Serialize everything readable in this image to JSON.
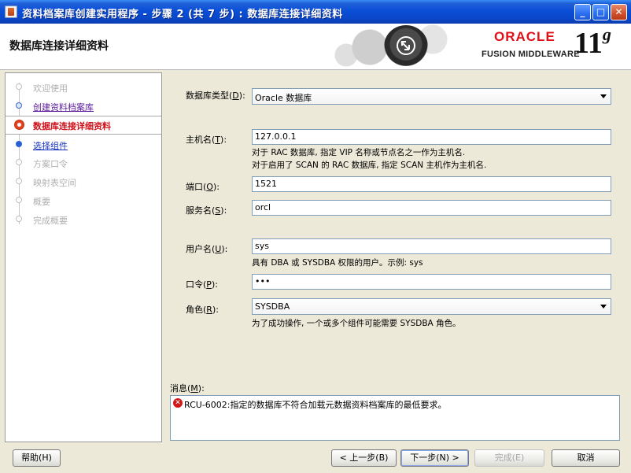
{
  "window": {
    "title": "资料档案库创建实用程序 - 步骤 2 (共 7 步) : 数据库连接详细资料",
    "minimize": "_",
    "maximize": "□",
    "close": "✕"
  },
  "header": {
    "page_title": "数据库连接详细资料",
    "brand_oracle": "ORACLE",
    "brand_fmw": "FUSION MIDDLEWARE",
    "version": "11",
    "version_suffix": "g"
  },
  "nav": {
    "steps": [
      {
        "label": "欢迎使用",
        "state": "disabled"
      },
      {
        "label": "创建资料档案库",
        "state": "done"
      },
      {
        "label": "数据库连接详细资料",
        "state": "current"
      },
      {
        "label": "选择组件",
        "state": "next"
      },
      {
        "label": "方案口令",
        "state": "disabled"
      },
      {
        "label": "映射表空间",
        "state": "disabled"
      },
      {
        "label": "概要",
        "state": "disabled"
      },
      {
        "label": "完成概要",
        "state": "disabled"
      }
    ]
  },
  "form": {
    "db_type": {
      "label": "数据库类型(",
      "mnemonic": "D",
      "label_end": "):",
      "value": "Oracle 数据库"
    },
    "host": {
      "label": "主机名(",
      "mnemonic": "T",
      "label_end": "):",
      "value": "127.0.0.1",
      "hint1": "对于 RAC 数据库, 指定 VIP 名称或节点名之一作为主机名.",
      "hint2": "对于启用了 SCAN 的 RAC 数据库, 指定 SCAN 主机作为主机名."
    },
    "port": {
      "label": "端口(",
      "mnemonic": "O",
      "label_end": "):",
      "value": "1521"
    },
    "service": {
      "label": "服务名(",
      "mnemonic": "S",
      "label_end": "):",
      "value": "orcl"
    },
    "user": {
      "label": "用户名(",
      "mnemonic": "U",
      "label_end": "):",
      "value": "sys",
      "hint": "具有 DBA 或 SYSDBA 权限的用户。示例: sys"
    },
    "password": {
      "label": "口令(",
      "mnemonic": "P",
      "label_end": "):",
      "value": "•••"
    },
    "role": {
      "label": "角色(",
      "mnemonic": "R",
      "label_end": "):",
      "value": "SYSDBA",
      "hint": "为了成功操作, 一个或多个组件可能需要 SYSDBA 角色。"
    }
  },
  "messages": {
    "label": "消息(",
    "mnemonic": "M",
    "label_end": "):",
    "text": "RCU-6002:指定的数据库不符合加载元数据资料档案库的最低要求。"
  },
  "buttons": {
    "help": "帮助(H)",
    "back": "< 上一步(B)",
    "next": "下一步(N) >",
    "finish": "完成(E)",
    "cancel": "取消"
  }
}
